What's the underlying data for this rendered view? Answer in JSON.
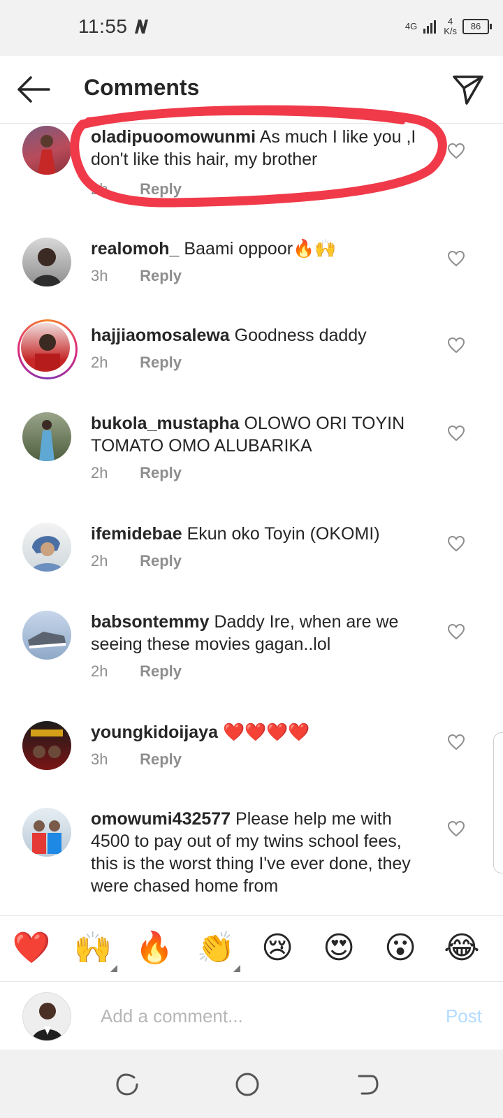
{
  "status_bar": {
    "time": "11:55",
    "network": "4G",
    "speed_value": "4",
    "speed_unit": "K/s",
    "battery": "86"
  },
  "header": {
    "title": "Comments"
  },
  "reply_label": "Reply",
  "comments": [
    {
      "username": "oladipuoomowunmi",
      "text": "As much I like you ,I don't like this hair, my brother",
      "time": "2h"
    },
    {
      "username": "realomoh_",
      "text": "Baami oppoor🔥🙌",
      "time": "3h"
    },
    {
      "username": "hajjiaomosalewa",
      "text": "Goodness daddy",
      "time": "2h"
    },
    {
      "username": "bukola_mustapha",
      "text": "OLOWO ORI TOYIN TOMATO OMO ALUBARIKA",
      "time": "2h"
    },
    {
      "username": "ifemidebae",
      "text": "Ekun oko Toyin (OKOMI)",
      "time": "2h"
    },
    {
      "username": "babsontemmy",
      "text": "Daddy Ire, when are we seeing these movies gagan..lol",
      "time": "2h"
    },
    {
      "username": "youngkidoijaya",
      "text": "❤️❤️❤️❤️",
      "time": "3h"
    },
    {
      "username": "omowumi432577",
      "text": "Please help me with 4500 to pay out of my twins school fees, this is the worst thing I've ever done, they were chased home from",
      "time": ""
    }
  ],
  "emoji_bar": [
    "❤️",
    "🙌",
    "🔥",
    "👏",
    "😢",
    "😍",
    "😮",
    "😂"
  ],
  "comment_input": {
    "placeholder": "Add a comment...",
    "post_label": "Post"
  },
  "colors": {
    "annotation": "#f03a4a",
    "post": "#b3dbff",
    "meta": "#8e8e8e"
  }
}
